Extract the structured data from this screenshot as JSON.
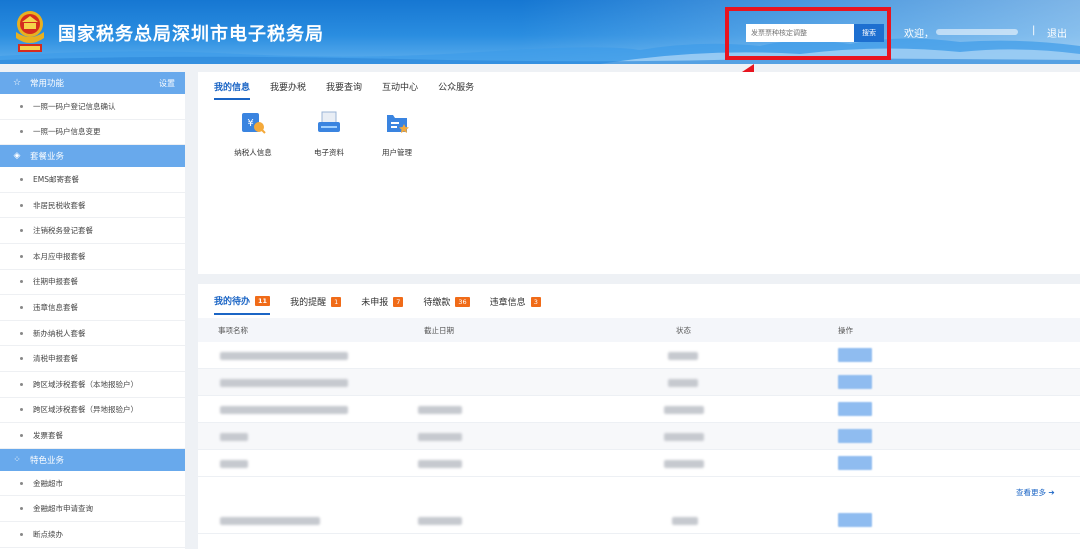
{
  "header": {
    "title": "国家税务总局深圳市电子税务局",
    "search_placeholder": "发票票种核定调整",
    "search_button": "搜索",
    "welcome": "欢迎，",
    "separator": "|",
    "logout": "退出"
  },
  "sidebar": {
    "sections": [
      {
        "title": "常用功能",
        "icon": "star-icon",
        "action": "设置",
        "items": [
          "一照一码户登记信息确认",
          "一照一码户信息变更"
        ]
      },
      {
        "title": "套餐业务",
        "icon": "layers-icon",
        "items": [
          "EMS邮寄套餐",
          "非居民税收套餐",
          "注销税务登记套餐",
          "本月应申报套餐",
          "往期申报套餐",
          "违章信息套餐",
          "新办纳税人套餐",
          "清税申报套餐",
          "跨区域涉税套餐（本地报验户）",
          "跨区域涉税套餐（异地报验户）",
          "发票套餐"
        ]
      },
      {
        "title": "特色业务",
        "icon": "grid-icon",
        "items": [
          "金融超市",
          "金融超市申请查询",
          "断点续办"
        ]
      }
    ]
  },
  "main": {
    "tabs": [
      "我的信息",
      "我要办税",
      "我要查询",
      "互动中心",
      "公众服务"
    ],
    "quick_links": [
      {
        "label": "纳税人信息",
        "icon": "taxpayer-info-icon"
      },
      {
        "label": "电子资料",
        "icon": "e-document-icon"
      },
      {
        "label": "用户管理",
        "icon": "user-management-icon"
      }
    ]
  },
  "tasks": {
    "tabs": [
      {
        "label": "我的待办",
        "count": "11"
      },
      {
        "label": "我的提醒",
        "count": "1"
      },
      {
        "label": "未申报",
        "count": "7"
      },
      {
        "label": "待缴款",
        "count": "36"
      },
      {
        "label": "违章信息",
        "count": "3"
      }
    ],
    "columns": [
      "事项名称",
      "截止日期",
      "状态",
      "操作"
    ],
    "view_more": "查看更多"
  },
  "colors": {
    "header_blue": "#1677d2",
    "sidebar_section": "#68a9ec",
    "active_tab": "#1b65c5",
    "badge": "#f06b18",
    "highlight_red": "#e8141f"
  }
}
